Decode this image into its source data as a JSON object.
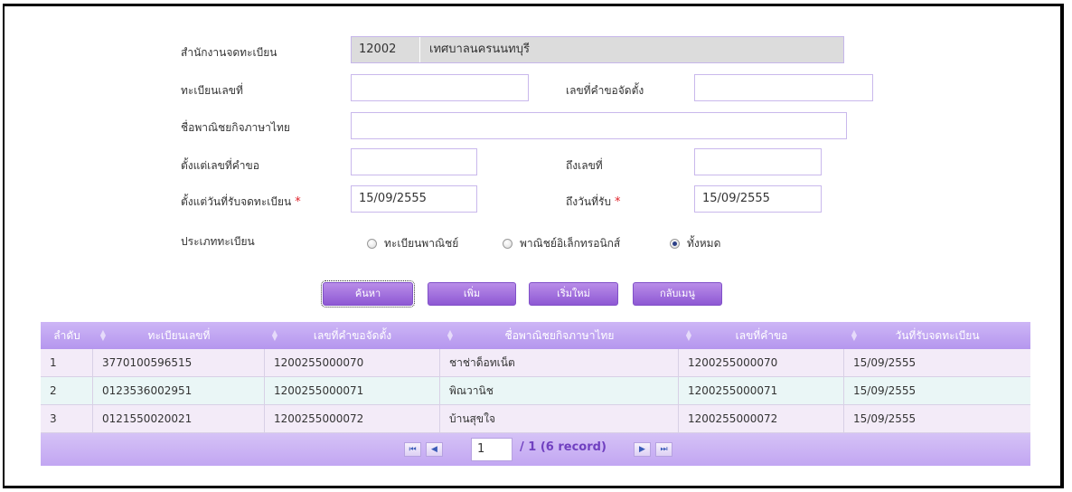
{
  "form": {
    "office_label": "สำนักงานจดทะเบียน",
    "office_code": "12002",
    "office_name": "เทศบาลนครนนทบุรี",
    "reg_no_label": "ทะเบียนเลขที่",
    "reg_no_value": "",
    "request_no_label": "เลขที่คำขอจัดตั้ง",
    "request_no_value": "",
    "company_name_label": "ชื่อพาณิชยกิจภาษาไทย",
    "company_name_value": "",
    "from_request_label": "ตั้งแต่เลขที่คำขอ",
    "from_request_value": "",
    "to_no_label": "ถึงเลขที่",
    "to_no_value": "",
    "from_date_label": "ตั้งแต่วันที่รับจดทะเบียน",
    "from_date_value": "15/09/2555",
    "to_date_label": "ถึงวันที่รับ",
    "to_date_value": "15/09/2555",
    "required_mark": "*",
    "reg_type_label": "ประเภททะเบียน",
    "reg_type_options": [
      "ทะเบียนพาณิชย์",
      "พาณิชย์อิเล็กทรอนิกส์",
      "ทั้งหมด"
    ],
    "reg_type_selected": "ทั้งหมด"
  },
  "buttons": {
    "search": "ค้นหา",
    "add": "เพิ่ม",
    "reset": "เริ่มใหม่",
    "menu": "กลับเมนู"
  },
  "table": {
    "columns": [
      "ลำดับ",
      "ทะเบียนเลขที่",
      "เลขที่คำขอจัดตั้ง",
      "ชื่อพาณิชยกิจภาษาไทย",
      "เลขที่คำขอ",
      "วันที่รับจดทะเบียน"
    ],
    "rows": [
      [
        "1",
        "3770100596515",
        "1200255000070",
        "ชาช่าด็อทเน็ต",
        "1200255000070",
        "15/09/2555"
      ],
      [
        "2",
        "0123536002951",
        "1200255000071",
        "พิณวานิช",
        "1200255000071",
        "15/09/2555"
      ],
      [
        "3",
        "0121550020021",
        "1200255000072",
        "บ้านสุขใจ",
        "1200255000072",
        "15/09/2555"
      ]
    ]
  },
  "pager": {
    "page": "1",
    "summary": "/ 1 (6 record)"
  },
  "colors": {
    "accent": "#9b6ad8",
    "header": "#c2a6f2",
    "required": "#e0222a"
  }
}
